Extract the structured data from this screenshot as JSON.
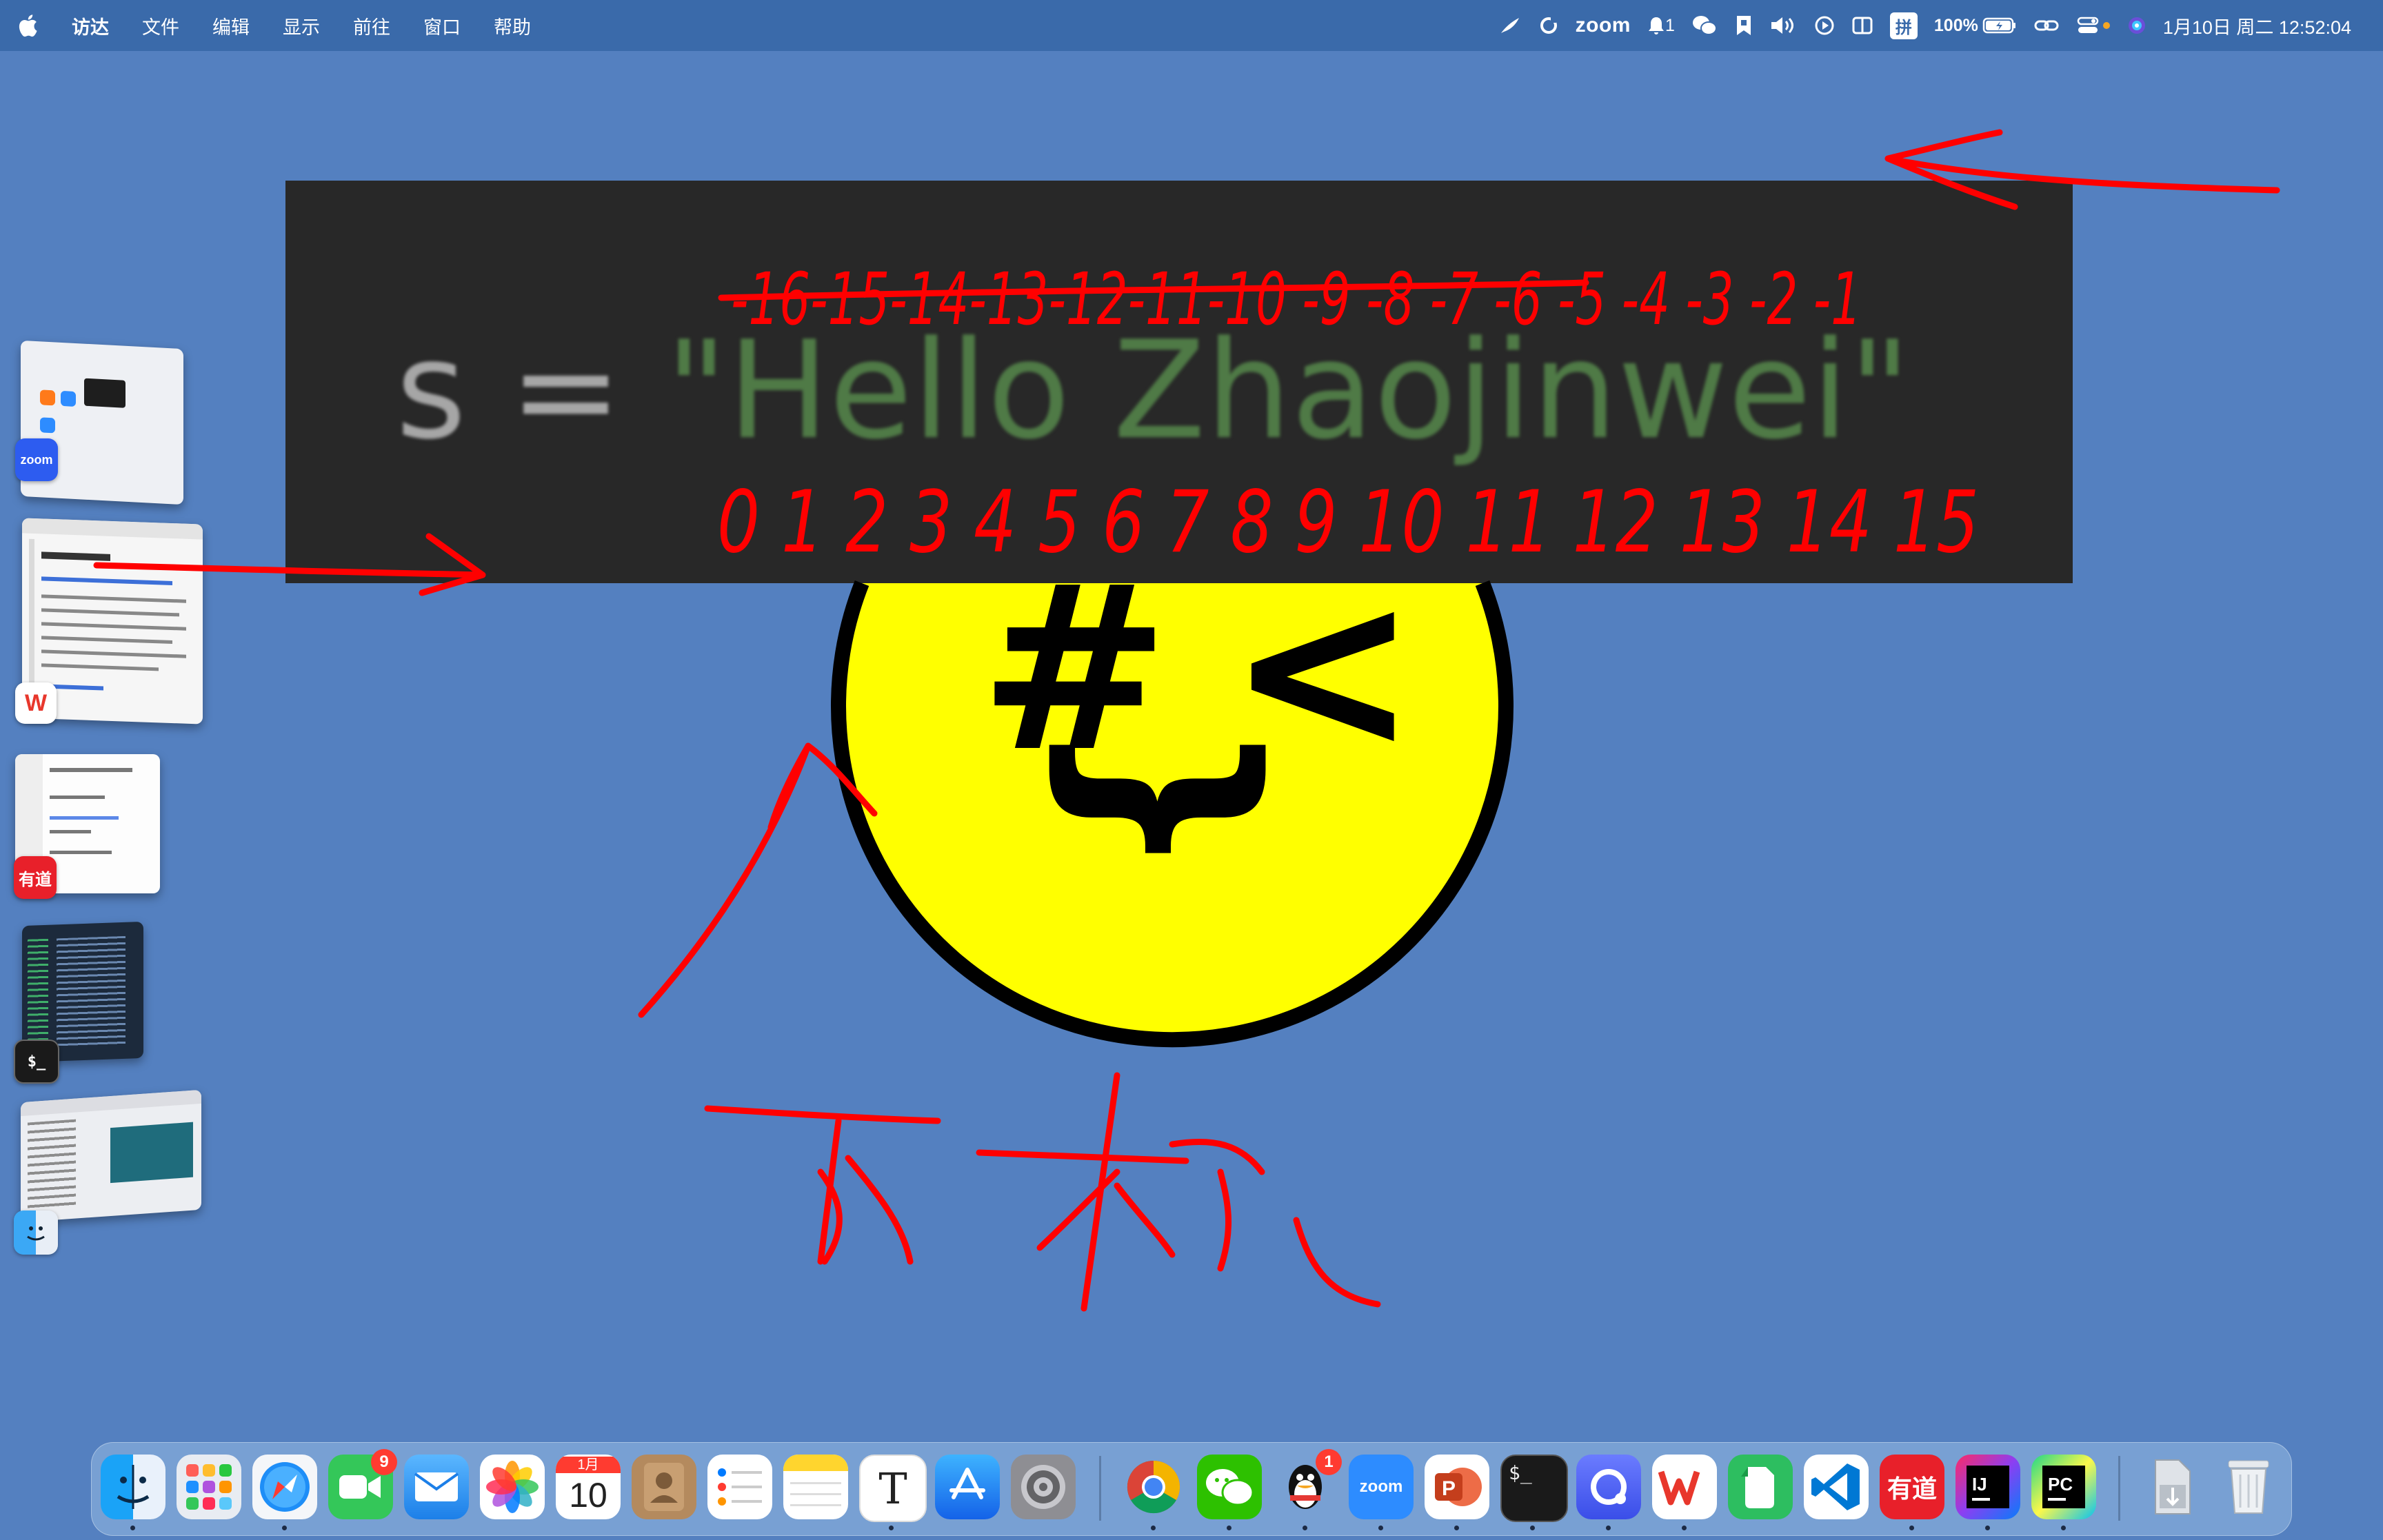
{
  "menubar": {
    "items": [
      "访达",
      "文件",
      "编辑",
      "显示",
      "前往",
      "窗口",
      "帮助"
    ],
    "status": {
      "zoom_label": "zoom",
      "notification_count": "1",
      "input_method": "拼",
      "battery_percent": "100%",
      "datetime": "1月10日 周二  12:52:04"
    }
  },
  "code": {
    "variable": "s",
    "operator": "=",
    "string": "\"Hello Zhaojinwei\"",
    "colors": {
      "background": "#282828",
      "identifier": "#a6a6a6",
      "string": "#4f7a46"
    }
  },
  "smiley": {
    "eye_left": "#",
    "eye_right": "<",
    "mouth": "{",
    "colors": {
      "face": "#ffff00",
      "outline": "#000000"
    }
  },
  "annotations": {
    "color": "#ff0000",
    "negative_indices": "-16-15-14-13-12-11-10 -9 -8 -7 -6 -5 -4 -3 -2 -1",
    "positive_indices": "0 1 2 3 4 5 6 7 8 9 10 11 12 13 14 15",
    "handwritten_text": "下标"
  },
  "side_windows": [
    {
      "app": "zoom",
      "icon_label": "zoom"
    },
    {
      "app": "wps",
      "icon_label": "W"
    },
    {
      "app": "youdao",
      "icon_label": "有道"
    },
    {
      "app": "terminal",
      "icon_label": "$_"
    },
    {
      "app": "finder",
      "icon_label": ""
    }
  ],
  "dock": {
    "apps": [
      {
        "name": "Finder",
        "icon": "finder-icon"
      },
      {
        "name": "Launchpad",
        "icon": "launchpad-icon"
      },
      {
        "name": "Safari",
        "icon": "safari-icon"
      },
      {
        "name": "FaceTime",
        "icon": "facetime-icon",
        "badge": "9"
      },
      {
        "name": "Mail",
        "icon": "mail-icon"
      },
      {
        "name": "Photos",
        "icon": "photos-icon"
      },
      {
        "name": "Calendar",
        "icon": "calendar-icon",
        "month": "1月",
        "day": "10"
      },
      {
        "name": "Contacts",
        "icon": "contacts-icon"
      },
      {
        "name": "Reminders",
        "icon": "reminders-icon"
      },
      {
        "name": "Notes",
        "icon": "notes-icon"
      },
      {
        "name": "Typora",
        "icon": "typora-icon",
        "letter": "T"
      },
      {
        "name": "App Store",
        "icon": "appstore-icon"
      },
      {
        "name": "System Settings",
        "icon": "settings-icon"
      },
      {
        "name": "Chrome",
        "icon": "chrome-icon"
      },
      {
        "name": "WeChat",
        "icon": "wechat-icon"
      },
      {
        "name": "QQ",
        "icon": "qq-icon",
        "badge": "1"
      },
      {
        "name": "Zoom",
        "icon": "zoom-icon",
        "label": "zoom"
      },
      {
        "name": "PowerPoint",
        "icon": "powerpoint-icon",
        "letter": "P"
      },
      {
        "name": "Terminal",
        "icon": "terminal-icon",
        "label": "$_"
      },
      {
        "name": "Quark",
        "icon": "quark-icon"
      },
      {
        "name": "WPS",
        "icon": "wps-icon"
      },
      {
        "name": "Evernote",
        "icon": "evernote-icon"
      },
      {
        "name": "VS Code",
        "icon": "vscode-icon"
      },
      {
        "name": "Youdao",
        "icon": "youdao-icon",
        "label": "有道"
      },
      {
        "name": "IntelliJ IDEA",
        "icon": "intellij-icon",
        "label": "IJ"
      },
      {
        "name": "PyCharm",
        "icon": "pycharm-icon",
        "label": "PC"
      },
      {
        "name": "Downloads",
        "icon": "downloads-icon"
      },
      {
        "name": "Trash",
        "icon": "trash-icon"
      }
    ]
  }
}
